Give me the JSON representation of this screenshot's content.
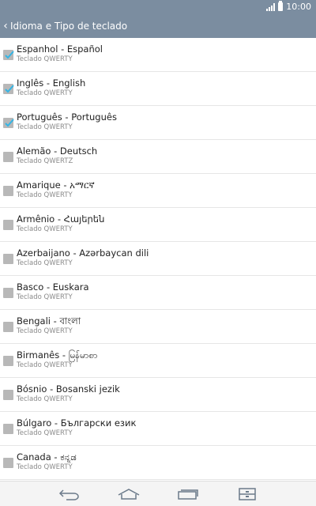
{
  "status_bar": {
    "time": "10:00"
  },
  "action_bar": {
    "title": "Idioma e Tipo de teclado"
  },
  "languages": [
    {
      "name": "Espanhol - Español",
      "layout": "Teclado QWERTY",
      "checked": true
    },
    {
      "name": "Inglês - English",
      "layout": "Teclado QWERTY",
      "checked": true
    },
    {
      "name": "Português - Português",
      "layout": "Teclado QWERTY",
      "checked": true
    },
    {
      "name": "Alemão - Deutsch",
      "layout": "Teclado QWERTZ",
      "checked": false
    },
    {
      "name": "Amarique - አማርኛ",
      "layout": "Teclado QWERTY",
      "checked": false
    },
    {
      "name": "Armênio - Հայերեն",
      "layout": "Teclado QWERTY",
      "checked": false
    },
    {
      "name": "Azerbaijano - Azərbaycan dili",
      "layout": "Teclado QWERTY",
      "checked": false
    },
    {
      "name": "Basco - Euskara",
      "layout": "Teclado QWERTY",
      "checked": false
    },
    {
      "name": "Bengali - বাংলা",
      "layout": "Teclado QWERTY",
      "checked": false
    },
    {
      "name": "Birmanês - မြန်မာစာ",
      "layout": "Teclado QWERTY",
      "checked": false
    },
    {
      "name": "Bósnio - Bosanski jezik",
      "layout": "Teclado QWERTY",
      "checked": false
    },
    {
      "name": "Búlgaro - Български език",
      "layout": "Teclado QWERTY",
      "checked": false
    },
    {
      "name": "Canada - ಕನ್ನಡ",
      "layout": "Teclado QWERTY",
      "checked": false
    }
  ],
  "colors": {
    "header": "#7b8da0",
    "check_mark": "#35b5e5",
    "checkbox": "#b8b8b8"
  },
  "nav_bar": {
    "icons": [
      "back-icon",
      "home-icon",
      "recents-icon",
      "menu-icon"
    ]
  }
}
